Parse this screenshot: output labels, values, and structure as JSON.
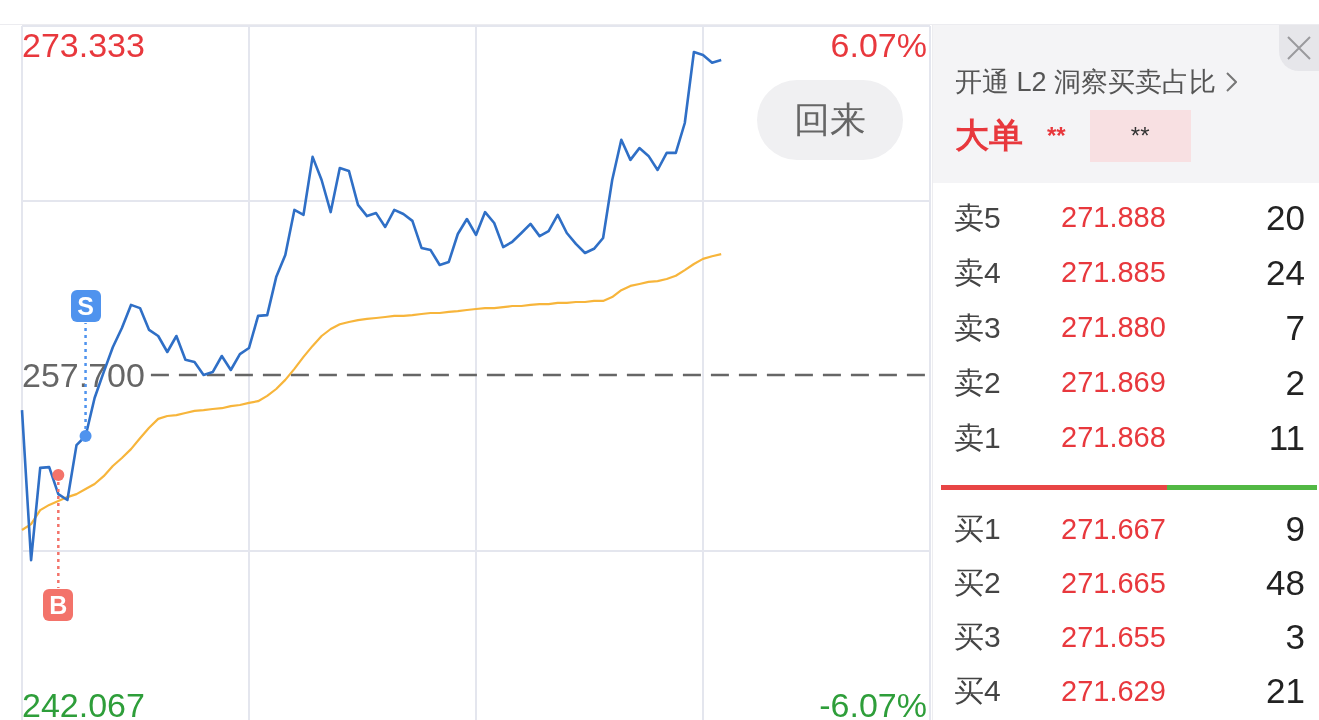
{
  "chart": {
    "back_button": "回来",
    "chart_data": [
      {
        "type": "line",
        "ylim": [
          241.36,
          274.28
        ],
        "yticks": [
          {
            "value": 242.067,
            "label": "242.067"
          },
          {
            "value": 273.333,
            "label": "273.333"
          }
        ],
        "y2lim": [
          -6.35,
          6.44
        ],
        "y2ticks": [
          {
            "value": -6.07,
            "label": "-6.07%"
          },
          {
            "value": 6.07,
            "label": "6.07%"
          }
        ],
        "grid": true,
        "ref_lines": [
          {
            "axis": "y",
            "value": 257.7,
            "label": "257.700",
            "color": "#666666",
            "line_style": "dashed"
          }
        ],
        "series": [
          {
            "color": "#2f6fc6",
            "values": [
              256.04,
              248.93,
              253.3,
              253.34,
              252.06,
              251.78,
              254.38,
              254.81,
              256.61,
              257.84,
              259.02,
              259.93,
              261.02,
              260.87,
              259.84,
              259.55,
              258.79,
              259.55,
              258.42,
              258.32,
              257.7,
              257.84,
              258.6,
              257.94,
              258.69,
              258.98,
              260.5,
              260.54,
              262.34,
              263.39,
              265.52,
              265.29,
              268.03,
              266.94,
              265.42,
              267.5,
              267.37,
              265.76,
              265.23,
              265.37,
              264.71,
              265.52,
              265.33,
              265.0,
              263.72,
              263.62,
              262.91,
              263.06,
              264.38,
              265.09,
              264.34,
              265.42,
              264.9,
              263.76,
              264.01,
              264.43,
              264.86,
              264.28,
              264.52,
              265.29,
              264.43,
              263.91,
              263.48,
              263.68,
              264.19,
              266.94,
              268.84,
              267.89,
              268.45,
              268.08,
              267.41,
              268.22,
              268.22,
              269.64,
              273.0,
              272.86,
              272.49,
              272.62,
              null,
              null,
              null,
              null,
              null,
              null,
              null,
              null,
              null,
              null,
              null,
              null,
              null,
              null,
              null,
              null,
              null,
              null,
              null,
              null,
              null,
              null,
              null
            ]
          },
          {
            "color": "#f7b53b",
            "values": [
              250.36,
              250.64,
              251.3,
              251.55,
              251.73,
              251.92,
              252.06,
              252.3,
              252.54,
              252.91,
              253.39,
              253.77,
              254.19,
              254.71,
              255.2,
              255.62,
              255.76,
              255.8,
              255.9,
              256.0,
              256.04,
              256.09,
              256.13,
              256.23,
              256.28,
              256.38,
              256.46,
              256.71,
              257.04,
              257.47,
              257.99,
              258.56,
              259.08,
              259.55,
              259.88,
              260.11,
              260.21,
              260.3,
              260.36,
              260.4,
              260.45,
              260.5,
              260.5,
              260.54,
              260.59,
              260.64,
              260.64,
              260.69,
              260.73,
              260.78,
              260.83,
              260.87,
              260.87,
              260.92,
              260.97,
              260.97,
              261.02,
              261.06,
              261.06,
              261.12,
              261.12,
              261.16,
              261.16,
              261.21,
              261.21,
              261.39,
              261.72,
              261.92,
              262.01,
              262.11,
              262.15,
              262.25,
              262.4,
              262.67,
              262.96,
              263.2,
              263.33,
              263.43,
              null,
              null,
              null,
              null,
              null,
              null,
              null,
              null,
              null,
              null,
              null,
              null,
              null,
              null,
              null,
              null,
              null,
              null,
              null,
              null,
              null,
              null,
              null
            ]
          },
          {
            "type": "scatter",
            "color": "#4f93ee",
            "values": [
              null,
              null,
              null,
              null,
              null,
              null,
              null,
              254.81,
              null,
              null,
              null,
              null,
              null,
              null,
              null,
              null,
              null,
              null,
              null,
              null,
              null,
              null,
              null,
              null,
              null,
              null,
              null,
              null,
              null,
              null,
              null,
              null,
              null,
              null,
              null,
              null,
              null,
              null,
              null,
              null,
              null,
              null,
              null,
              null,
              null,
              null,
              null,
              null,
              null,
              null,
              null,
              null,
              null,
              null,
              null,
              null,
              null,
              null,
              null,
              null,
              null,
              null,
              null,
              null,
              null,
              null,
              null,
              null,
              null,
              null,
              null,
              null,
              null,
              null,
              null,
              null,
              null,
              null,
              null,
              null,
              null,
              null,
              null,
              null,
              null,
              null,
              null,
              null,
              null,
              null,
              null,
              null,
              null,
              null,
              null,
              null,
              null,
              null,
              null,
              null,
              null
            ]
          },
          {
            "type": "scatter",
            "color": "#f3736a",
            "values": [
              null,
              null,
              null,
              null,
              252.96,
              null,
              null,
              null,
              null,
              null,
              null,
              null,
              null,
              null,
              null,
              null,
              null,
              null,
              null,
              null,
              null,
              null,
              null,
              null,
              null,
              null,
              null,
              null,
              null,
              null,
              null,
              null,
              null,
              null,
              null,
              null,
              null,
              null,
              null,
              null,
              null,
              null,
              null,
              null,
              null,
              null,
              null,
              null,
              null,
              null,
              null,
              null,
              null,
              null,
              null,
              null,
              null,
              null,
              null,
              null,
              null,
              null,
              null,
              null,
              null,
              null,
              null,
              null,
              null,
              null,
              null,
              null,
              null,
              null,
              null,
              null,
              null,
              null,
              null,
              null,
              null,
              null,
              null,
              null,
              null,
              null,
              null,
              null,
              null,
              null,
              null,
              null,
              null,
              null,
              null,
              null,
              null,
              null,
              null,
              null,
              null
            ]
          }
        ],
        "annotations": [
          "S",
          "B"
        ]
      }
    ]
  },
  "order_panel": {
    "promo_link": "开通 L2 洞察买卖占比",
    "big_order": {
      "label": "大单",
      "ratio": "**",
      "value": "**"
    },
    "asks": [
      {
        "label": "卖5",
        "price": "271.888",
        "volume": "20"
      },
      {
        "label": "卖4",
        "price": "271.885",
        "volume": "24"
      },
      {
        "label": "卖3",
        "price": "271.880",
        "volume": "7"
      },
      {
        "label": "卖2",
        "price": "271.869",
        "volume": "2"
      },
      {
        "label": "卖1",
        "price": "271.868",
        "volume": "11"
      }
    ],
    "ratio_bar": {
      "level": 0.6
    },
    "bids": [
      {
        "label": "买1",
        "price": "271.667",
        "volume": "9"
      },
      {
        "label": "买2",
        "price": "271.665",
        "volume": "48"
      },
      {
        "label": "买3",
        "price": "271.655",
        "volume": "3"
      },
      {
        "label": "买4",
        "price": "271.629",
        "volume": "21"
      }
    ]
  }
}
